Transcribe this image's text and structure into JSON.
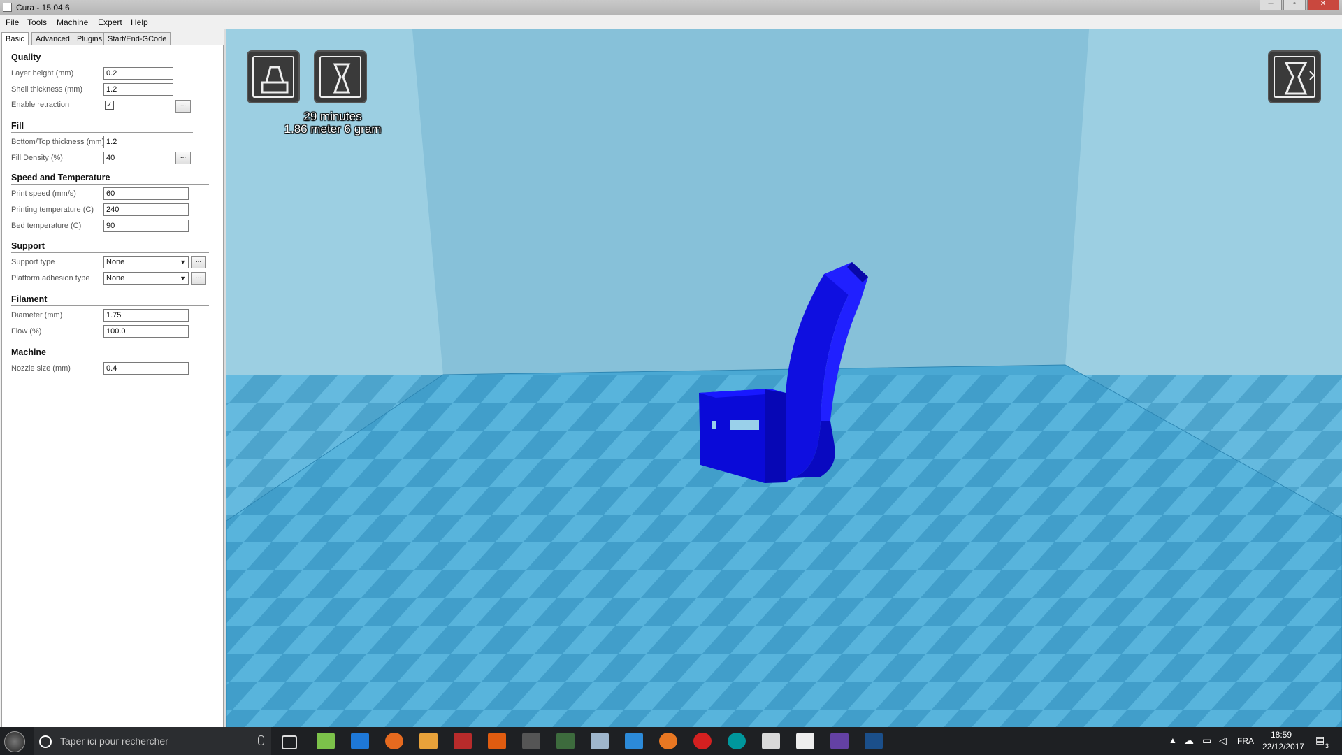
{
  "window": {
    "title": "Cura - 15.04.6",
    "controls": [
      "─",
      "▫",
      "✕"
    ]
  },
  "menu": [
    "File",
    "Tools",
    "Machine",
    "Expert",
    "Help"
  ],
  "tabs": [
    "Basic",
    "Advanced",
    "Plugins",
    "Start/End-GCode"
  ],
  "sections": {
    "quality": "Quality",
    "fill": "Fill",
    "speed": "Speed and Temperature",
    "support": "Support",
    "filament": "Filament",
    "machine": "Machine"
  },
  "fields": {
    "layer_height": {
      "label": "Layer height (mm)",
      "value": "0.2"
    },
    "shell_thickness": {
      "label": "Shell thickness (mm)",
      "value": "1.2"
    },
    "enable_retraction": {
      "label": "Enable retraction",
      "checked": true,
      "mark": "✓"
    },
    "bottom_top_thickness": {
      "label": "Bottom/Top thickness (mm)",
      "value": "1.2"
    },
    "fill_density": {
      "label": "Fill Density (%)",
      "value": "40"
    },
    "print_speed": {
      "label": "Print speed (mm/s)",
      "value": "60"
    },
    "printing_temperature": {
      "label": "Printing temperature (C)",
      "value": "240"
    },
    "bed_temperature": {
      "label": "Bed temperature (C)",
      "value": "90"
    },
    "support_type": {
      "label": "Support type",
      "value": "None"
    },
    "platform_adhesion": {
      "label": "Platform adhesion type",
      "value": "None"
    },
    "diameter": {
      "label": "Diameter (mm)",
      "value": "1.75"
    },
    "flow": {
      "label": "Flow (%)",
      "value": "100.0"
    },
    "nozzle_size": {
      "label": "Nozzle size (mm)",
      "value": "0.4"
    }
  },
  "more_button_label": "...",
  "print_info": {
    "time": "29 minutes",
    "material": "1.86 meter 6 gram"
  },
  "colors": {
    "model": "#1010e8",
    "floor_light": "#5bb6de",
    "floor_dark": "#3f9cc8",
    "walls": "#8fc5dc"
  },
  "taskbar": {
    "search_placeholder": "Taper ici pour rechercher",
    "language": "FRA",
    "time": "18:59",
    "date": "22/12/2017",
    "notification_count": "3"
  }
}
